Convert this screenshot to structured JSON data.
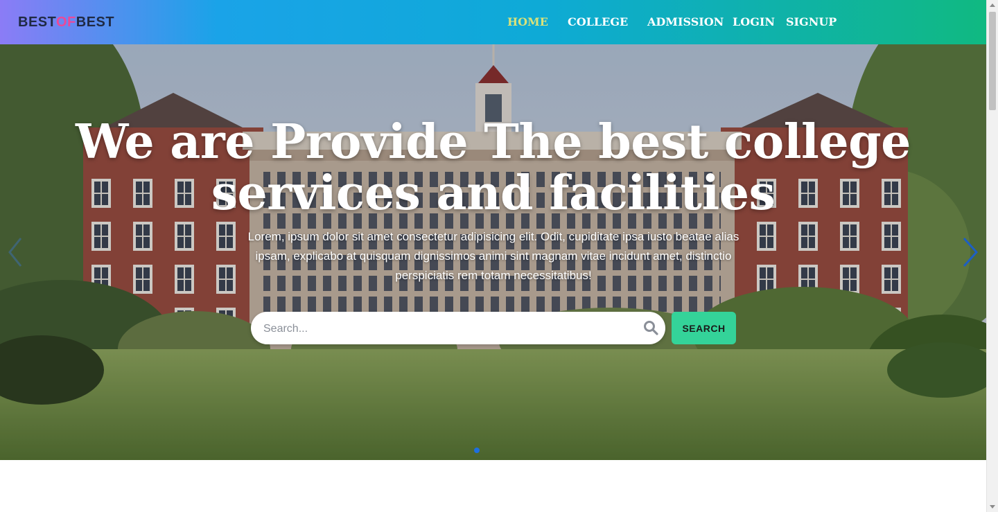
{
  "brand": {
    "logo_part1": "BEST",
    "logo_part2": "OF",
    "logo_part3": "BEST",
    "accent_color": "#ec4899",
    "dark_color": "#1f2a44"
  },
  "nav": {
    "items": [
      {
        "label": "HOME",
        "active": true
      },
      {
        "label": "COLLEGE",
        "active": false
      },
      {
        "label": "ADMISSION",
        "active": false
      },
      {
        "label": "LOGIN",
        "active": false
      },
      {
        "label": "SIGNUP",
        "active": false
      }
    ],
    "gradient": [
      "#8b7cf6",
      "#1aa3e8",
      "#10b981"
    ],
    "active_color": "#d9e27a"
  },
  "hero": {
    "title_line1": "We are Provide The best college",
    "title_line2": "services and facilities",
    "description": "Lorem, ipsum dolor sit amet consectetur adipisicing elit. Odit, cupiditate ipsa iusto beatae alias ipsam, explicabo at quisquam dignissimos animi sint magnam vitae incidunt amet, distinctio perspiciatis rem totam necessitatibus!",
    "background_image": "college-campus-building",
    "carousel_dots": 1,
    "prev_icon": "chevron-left-icon",
    "next_icon": "chevron-right-icon"
  },
  "search": {
    "placeholder": "Search...",
    "value": "",
    "icon": "search-icon",
    "button_label": "SEARCH",
    "button_color": "#34d399"
  }
}
